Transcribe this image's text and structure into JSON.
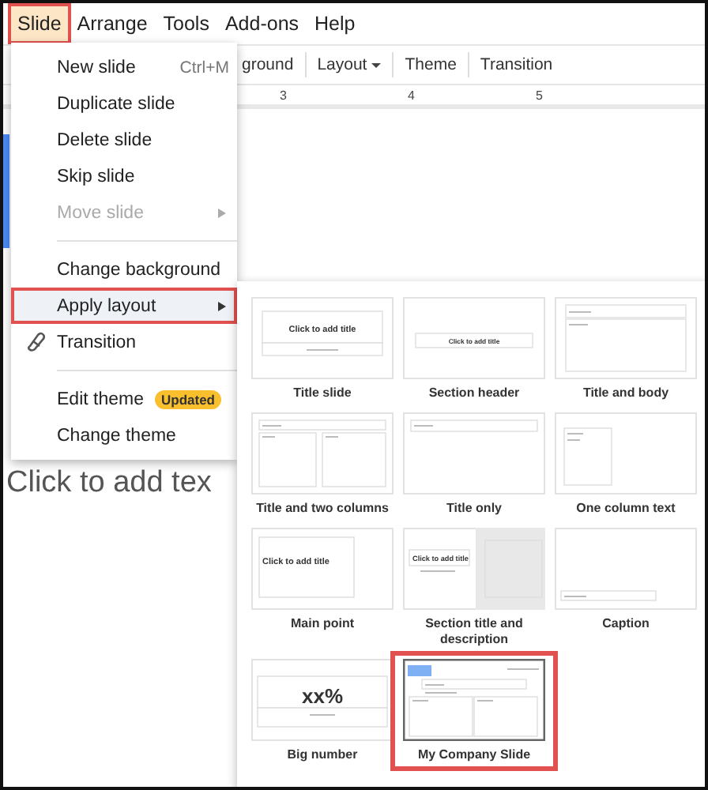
{
  "menubar": [
    {
      "label": "Slide",
      "selected": true,
      "outlined": true
    },
    {
      "label": "Arrange",
      "selected": false,
      "outlined": false
    },
    {
      "label": "Tools",
      "selected": false,
      "outlined": false
    },
    {
      "label": "Add-ons",
      "selected": false,
      "outlined": false
    },
    {
      "label": "Help",
      "selected": false,
      "outlined": false
    }
  ],
  "toolbar": [
    {
      "label": "ground",
      "dropdown": false
    },
    {
      "label": "Layout",
      "dropdown": true
    },
    {
      "label": "Theme",
      "dropdown": false
    },
    {
      "label": "Transition",
      "dropdown": false
    }
  ],
  "ruler": {
    "ticks": [
      "3",
      "4",
      "5"
    ]
  },
  "slide": {
    "body_placeholder": "Click to add tex"
  },
  "menu": {
    "groups": [
      [
        {
          "label": "New slide",
          "shortcut": "Ctrl+M",
          "disabled": false,
          "submenu": false,
          "highlighted": false,
          "outlined": false,
          "icon": false
        },
        {
          "label": "Duplicate slide",
          "disabled": false,
          "submenu": false,
          "highlighted": false,
          "outlined": false,
          "icon": false
        },
        {
          "label": "Delete slide",
          "disabled": false,
          "submenu": false,
          "highlighted": false,
          "outlined": false,
          "icon": false
        },
        {
          "label": "Skip slide",
          "disabled": false,
          "submenu": false,
          "highlighted": false,
          "outlined": false,
          "icon": false
        },
        {
          "label": "Move slide",
          "disabled": true,
          "submenu": true,
          "highlighted": false,
          "outlined": false,
          "icon": false
        }
      ],
      [
        {
          "label": "Change background",
          "disabled": false,
          "submenu": false,
          "highlighted": false,
          "outlined": false,
          "icon": false
        },
        {
          "label": "Apply layout",
          "disabled": false,
          "submenu": true,
          "highlighted": true,
          "outlined": true,
          "icon": false
        },
        {
          "label": "Transition",
          "disabled": false,
          "submenu": false,
          "highlighted": false,
          "outlined": false,
          "icon": true
        }
      ],
      [
        {
          "label": "Edit theme",
          "badge": "Updated",
          "disabled": false,
          "submenu": false,
          "highlighted": false,
          "outlined": false,
          "icon": false
        },
        {
          "label": "Change theme",
          "disabled": false,
          "submenu": false,
          "highlighted": false,
          "outlined": false,
          "icon": false
        }
      ]
    ]
  },
  "layouts": [
    {
      "label": "Title slide",
      "kind": "title",
      "title_text": "Click to add title",
      "outlined": false
    },
    {
      "label": "Section header",
      "kind": "section",
      "title_text": "Click to add title",
      "outlined": false
    },
    {
      "label": "Title and body",
      "kind": "title-body",
      "outlined": false
    },
    {
      "label": "Title and two columns",
      "kind": "two-columns",
      "outlined": false
    },
    {
      "label": "Title only",
      "kind": "title-only",
      "outlined": false
    },
    {
      "label": "One column text",
      "kind": "one-column",
      "outlined": false
    },
    {
      "label": "Main point",
      "kind": "main-point",
      "title_text": "Click to add title",
      "outlined": false
    },
    {
      "label": "Section title and description",
      "kind": "section-description",
      "title_text": "Click to add title",
      "outlined": false
    },
    {
      "label": "Caption",
      "kind": "caption",
      "outlined": false
    },
    {
      "label": "Big number",
      "kind": "big-number",
      "title_text": "xx%",
      "outlined": false
    },
    {
      "label": "My Company Slide",
      "kind": "custom",
      "outlined": true
    }
  ]
}
